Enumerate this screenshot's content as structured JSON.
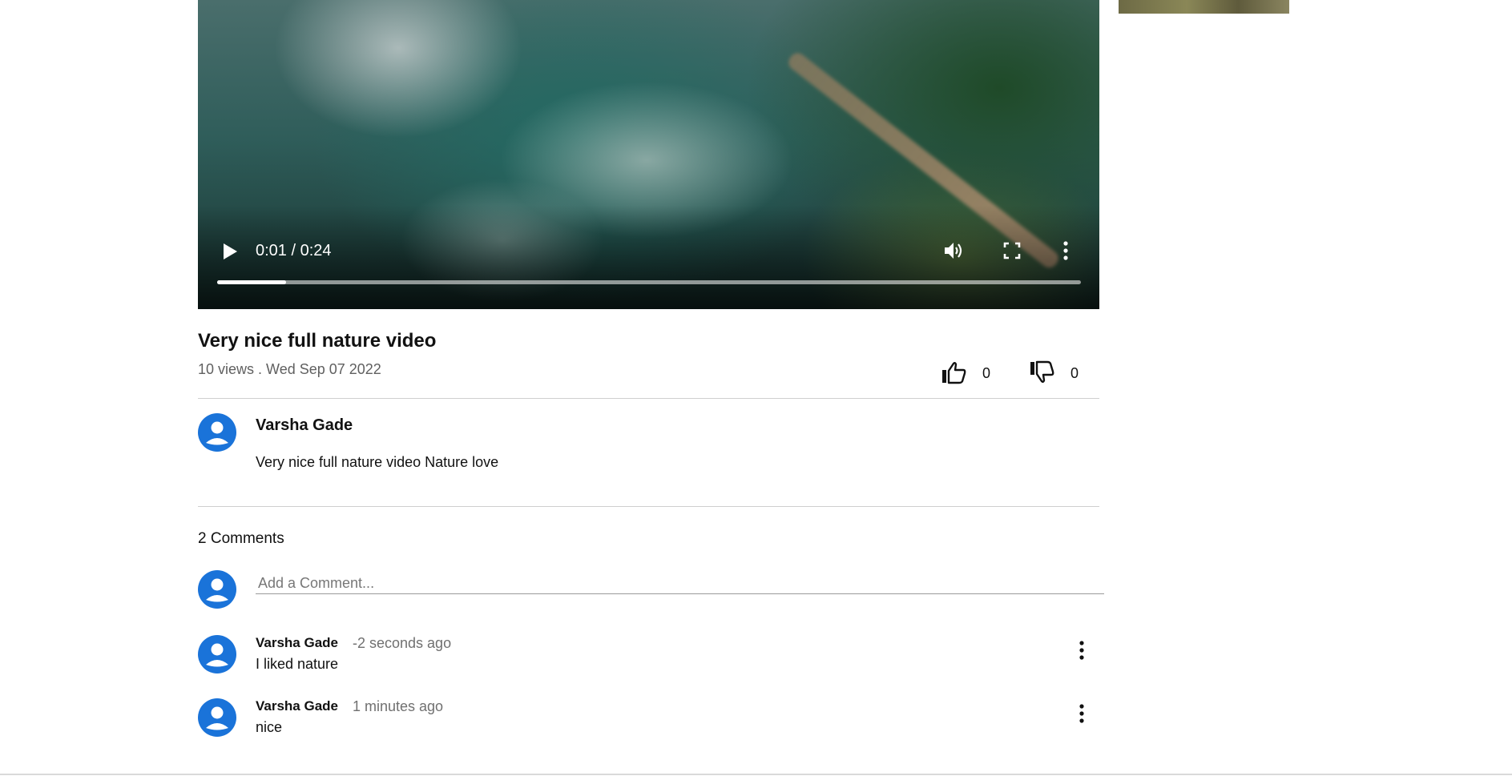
{
  "video": {
    "time_display": "0:01 / 0:24",
    "progress_fraction": 0.08
  },
  "info": {
    "title": "Very nice full nature video",
    "meta": "10 views . Wed Sep 07 2022",
    "likes": "0",
    "dislikes": "0"
  },
  "channel": {
    "name": "Varsha Gade",
    "description": "Very nice full nature video Nature love"
  },
  "comments": {
    "count_label": "2 Comments",
    "input_placeholder": "Add a Comment...",
    "items": [
      {
        "author": "Varsha Gade",
        "time": "-2 seconds ago",
        "text": "I liked nature"
      },
      {
        "author": "Varsha Gade",
        "time": "1 minutes ago",
        "text": "nice"
      }
    ]
  },
  "colors": {
    "avatar": "#1a73d9",
    "accent_text": "#606060"
  }
}
